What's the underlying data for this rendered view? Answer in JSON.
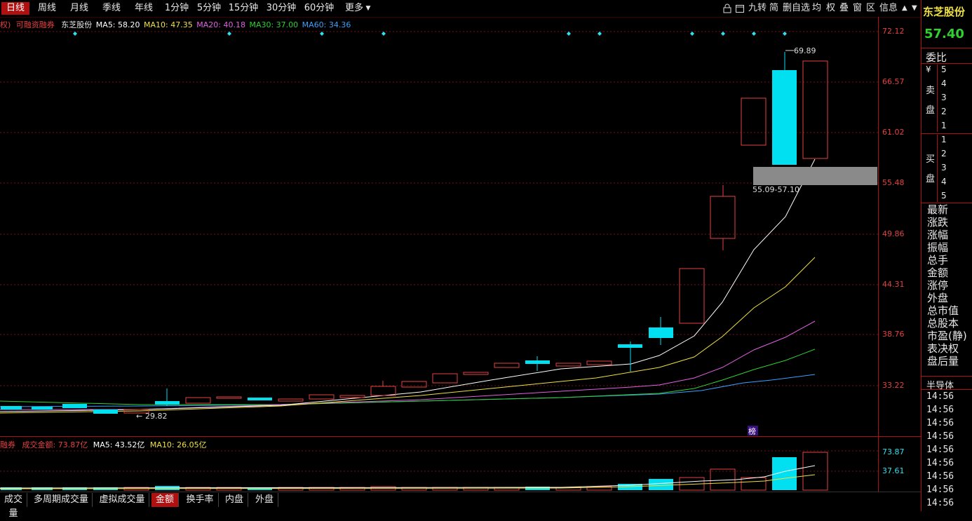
{
  "toolbar": {
    "periods": [
      "日线",
      "周线",
      "月线",
      "季线",
      "年线",
      "1分钟",
      "5分钟",
      "15分钟",
      "30分钟",
      "60分钟",
      "更多"
    ],
    "tools": [
      "九转",
      "简",
      "删自选",
      "均",
      "权",
      "叠",
      "窗",
      "区",
      "信息"
    ]
  },
  "stock": {
    "name": "东芝股份",
    "tag": "可融资融券",
    "prefix": "权)",
    "price": "57.40"
  },
  "ma_legend": {
    "ma5": "MA5: 58.20",
    "ma10": "MA10: 47.35",
    "ma20": "MA20: 40.18",
    "ma30": "MA30: 37.00",
    "ma60": "MA60: 34.36"
  },
  "price_axis": [
    "72.12",
    "66.57",
    "61.02",
    "55.48",
    "49.86",
    "44.31",
    "38.76",
    "33.22"
  ],
  "annotations": {
    "high": "69.89",
    "low": "29.82",
    "zone": "55.09-57.10",
    "rank_badge": "榜"
  },
  "volume": {
    "prefix": "融券",
    "label": "成交金额: 73.87亿",
    "ma5": "MA5: 43.52亿",
    "ma10": "MA10: 26.05亿",
    "axis": [
      "73.87",
      "37.61"
    ]
  },
  "right_panel": {
    "ratio_label": "委比",
    "sell_labels": [
      "¥",
      "卖",
      "盘"
    ],
    "buy_labels": [
      "买",
      "盘"
    ],
    "sell_levels": [
      "5",
      "4",
      "3",
      "2",
      "1"
    ],
    "buy_levels": [
      "1",
      "2",
      "3",
      "4",
      "5"
    ],
    "fields": [
      "最新",
      "涨跌",
      "涨幅",
      "振幅",
      "总手",
      "金额",
      "涨停",
      "外盘",
      "总市值",
      "总股本",
      "市盈(静)",
      "表决权",
      "盘后量"
    ],
    "sector": "半导体",
    "times": [
      "14:56",
      "14:56",
      "14:56",
      "14:56",
      "14:56",
      "14:56",
      "14:56",
      "14:56",
      "14:56"
    ]
  },
  "bottom_tabs": [
    "成交量",
    "多周期成交量",
    "虚拟成交量",
    "金额",
    "换手率",
    "内盘",
    "外盘"
  ],
  "colors": {
    "up": "#e34242",
    "down": "#00e0f0",
    "ma5": "#ffffff",
    "ma10": "#f0e040",
    "ma20": "#e060e0",
    "ma30": "#30d030",
    "ma60": "#3aa0ff",
    "accent_red": "#b01010"
  }
}
